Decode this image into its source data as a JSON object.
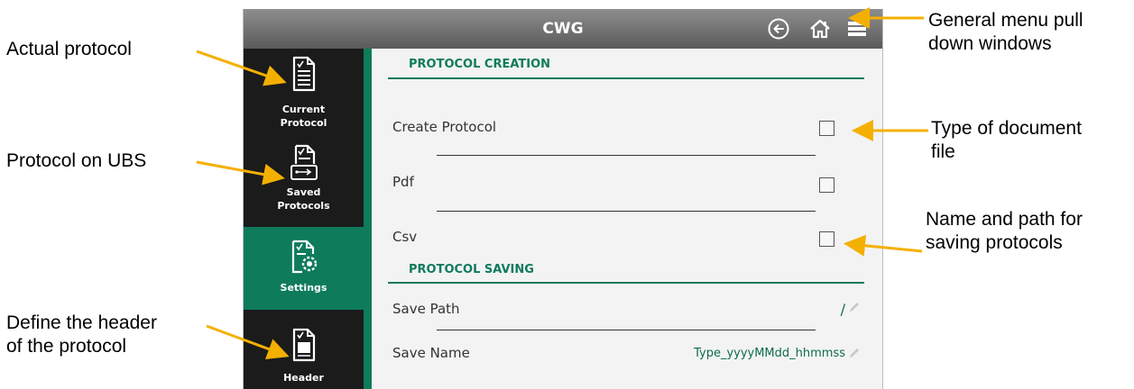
{
  "app": {
    "title": "CWG",
    "icons": [
      "back-circle-icon",
      "home-icon",
      "menu-icon"
    ]
  },
  "sidebar": {
    "items": [
      {
        "label_line1": "Current",
        "label_line2": "Protocol",
        "icon": "document-icon",
        "active": false
      },
      {
        "label_line1": "Saved",
        "label_line2": "Protocols",
        "icon": "document-usb-icon",
        "active": false
      },
      {
        "label_line1": "Settings",
        "label_line2": "",
        "icon": "document-gear-icon",
        "active": true
      },
      {
        "label_line1": "Header",
        "label_line2": "",
        "icon": "document-header-icon",
        "active": false
      }
    ]
  },
  "content": {
    "section_creation": {
      "title": "PROTOCOL CREATION",
      "rows": [
        {
          "label": "Create Protocol",
          "checked": false
        },
        {
          "label": "Pdf",
          "checked": false
        },
        {
          "label": "Csv",
          "checked": false
        }
      ]
    },
    "section_saving": {
      "title": "PROTOCOL SAVING",
      "rows": [
        {
          "label": "Save Path",
          "value": "/"
        },
        {
          "label": "Save Name",
          "value": "Type_yyyyMMdd_hhmmss"
        }
      ]
    }
  },
  "annotations": {
    "actual_protocol": "Actual protocol",
    "protocol_on_ubs": "Protocol on UBS",
    "define_header_1": "Define the header",
    "define_header_2": "of the protocol",
    "general_menu_1": "General menu pull",
    "general_menu_2": "down windows",
    "doc_type_1": "Type of document",
    "doc_type_2": "file",
    "name_path_1": "Name and path for",
    "name_path_2": "saving protocols"
  },
  "colors": {
    "accent_green": "#0e7b5b",
    "sidebar_dark": "#1b1b1b",
    "arrow_orange": "#f4b000",
    "titlebar": "#6e6e6e"
  }
}
